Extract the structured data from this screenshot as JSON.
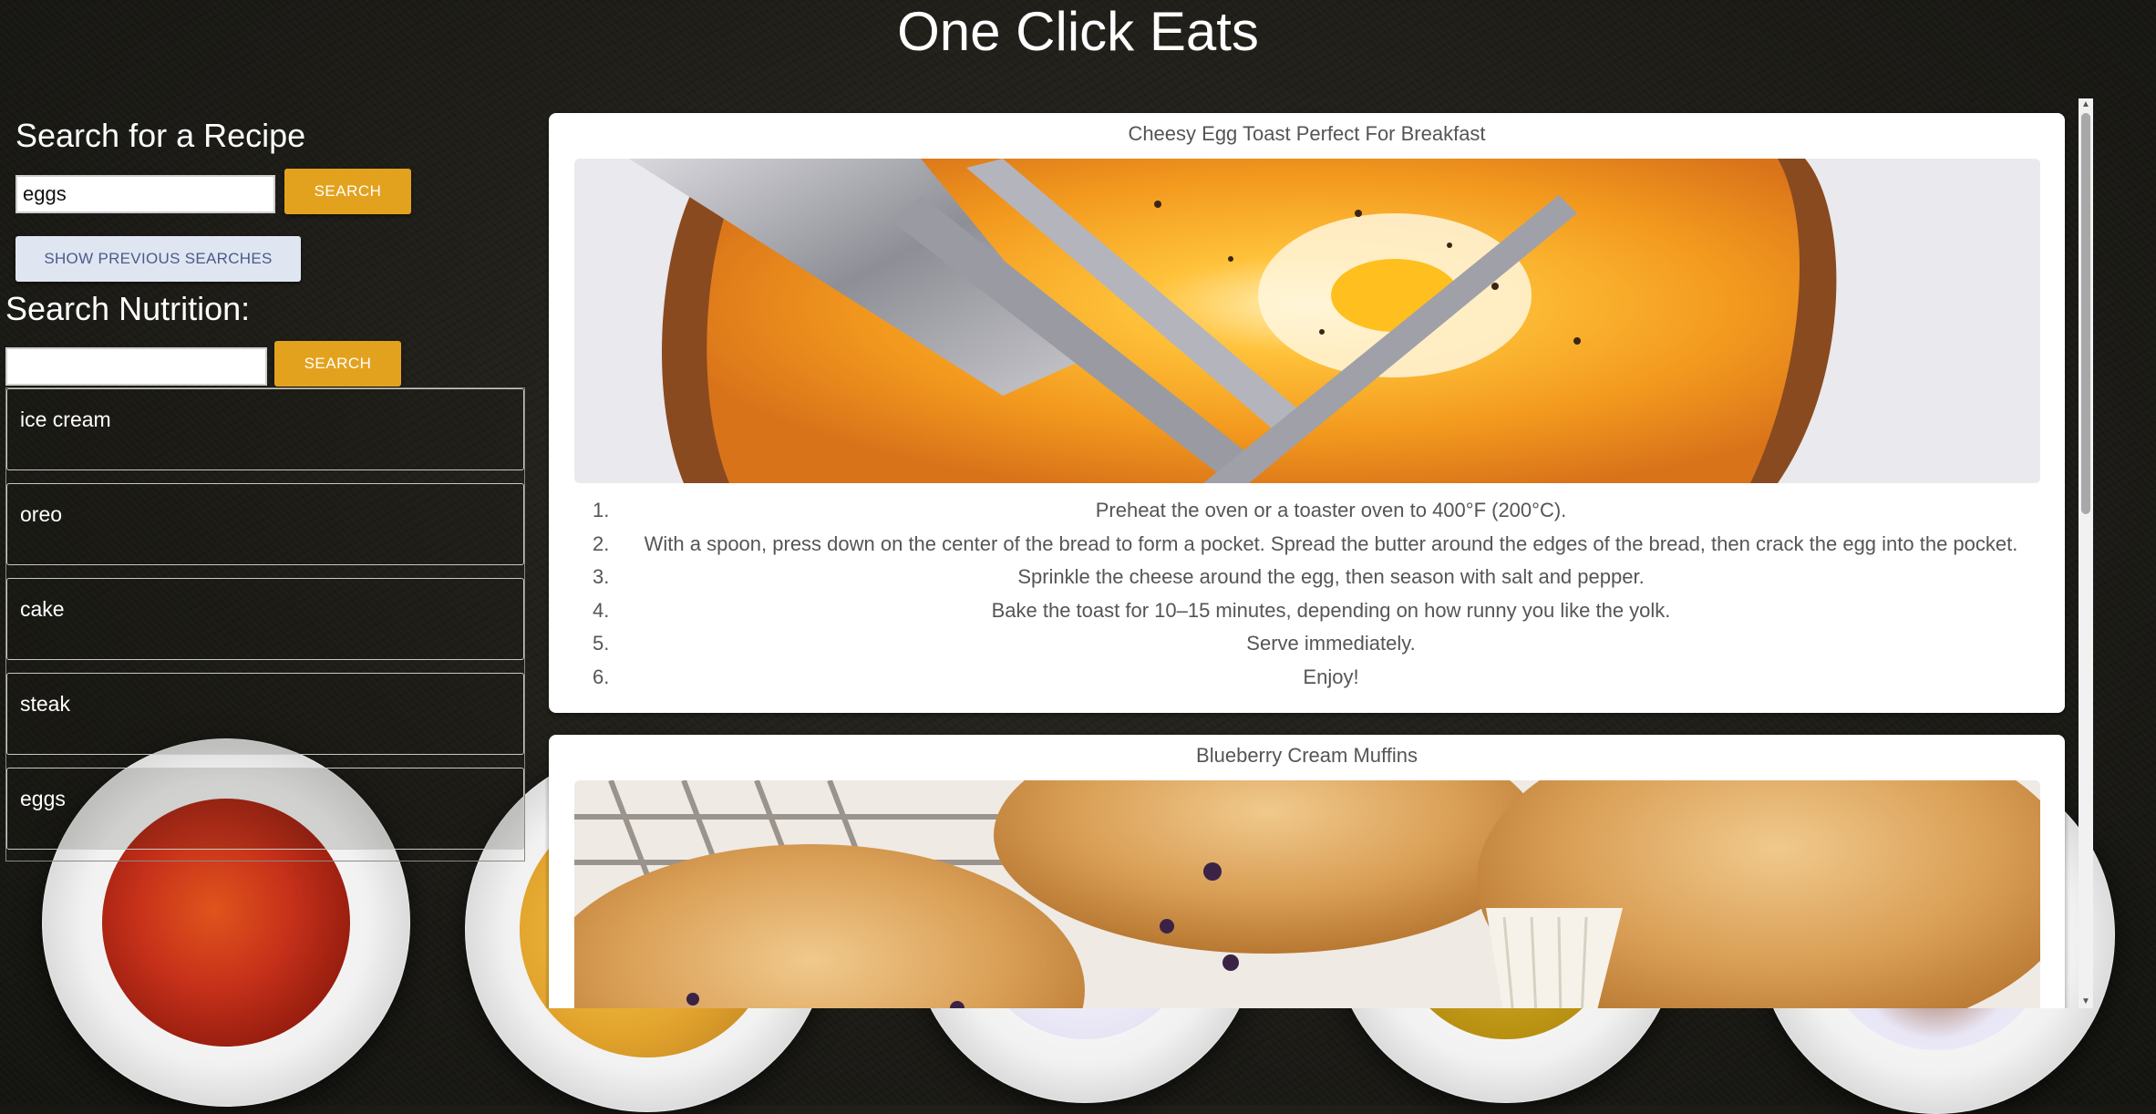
{
  "app": {
    "title": "One Click Eats"
  },
  "recipe_search": {
    "heading": "Search for a Recipe",
    "input_value": "eggs",
    "button_label": "SEARCH",
    "previous_button_label": "SHOW PREVIOUS SEARCHES"
  },
  "nutrition_search": {
    "heading": "Search Nutrition:",
    "input_value": "",
    "button_label": "SEARCH"
  },
  "previous_searches": [
    "ice cream",
    "oreo",
    "cake",
    "steak",
    "eggs"
  ],
  "recipes": [
    {
      "title": "Cheesy Egg Toast Perfect For Breakfast",
      "steps": [
        {
          "num": "1.",
          "text": "Preheat the oven or a toaster oven to 400°F (200°C)."
        },
        {
          "num": "2.",
          "text": "With a spoon, press down on the center of the bread to form a pocket. Spread the butter around the edges of the bread, then crack the egg into the pocket."
        },
        {
          "num": "3.",
          "text": "Sprinkle the cheese around the egg, then season with salt and pepper."
        },
        {
          "num": "4.",
          "text": "Bake the toast for 10–15 minutes, depending on how runny you like the yolk."
        },
        {
          "num": "5.",
          "text": "Serve immediately."
        },
        {
          "num": "6.",
          "text": "Enjoy!"
        }
      ]
    },
    {
      "title": "Blueberry Cream Muffins"
    }
  ],
  "colors": {
    "accent_button": "#e3a21e",
    "secondary_button": "#dfe6f1",
    "background": "#1e1d18"
  }
}
